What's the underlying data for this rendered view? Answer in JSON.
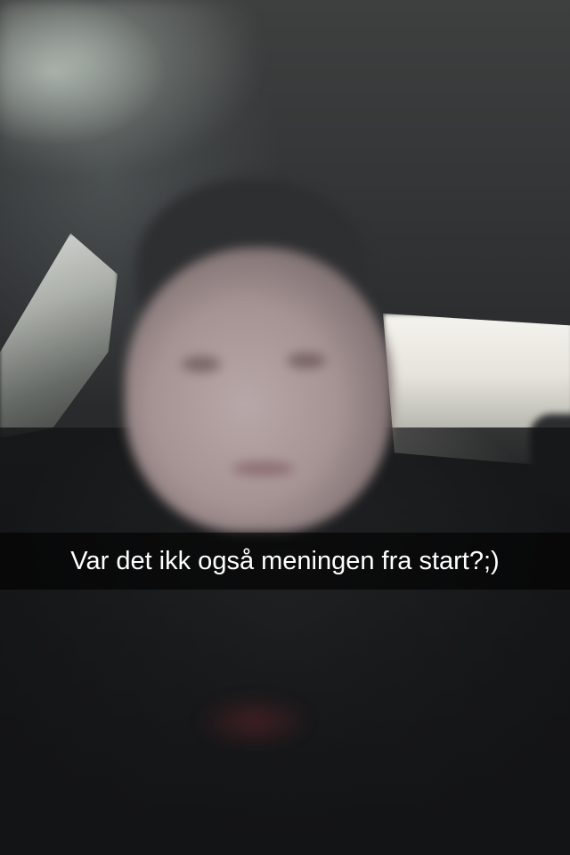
{
  "snap": {
    "caption": "Var det ikk også meningen fra start?;)"
  },
  "colors": {
    "caption_bar": "#000000",
    "caption_text": "#ffffff"
  }
}
